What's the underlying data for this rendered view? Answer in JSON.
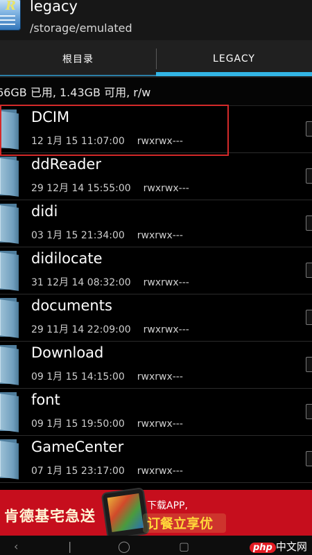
{
  "header": {
    "title": "legacy",
    "path": "/storage/emulated"
  },
  "tabs": [
    {
      "label": "根目录"
    },
    {
      "label": "LEGACY"
    }
  ],
  "storage_info": "66GB 已用, 1.43GB 可用, r/w",
  "files": [
    {
      "name": "DCIM",
      "date": "12 1月 15 11:07:00",
      "permissions": "rwxrwx---"
    },
    {
      "name": "ddReader",
      "date": "29 12月 14 15:55:00",
      "permissions": "rwxrwx---"
    },
    {
      "name": "didi",
      "date": "03 1月 15 21:34:00",
      "permissions": "rwxrwx---"
    },
    {
      "name": "didilocate",
      "date": "31 12月 14 08:32:00",
      "permissions": "rwxrwx---"
    },
    {
      "name": "documents",
      "date": "29 11月 14 22:09:00",
      "permissions": "rwxrwx---"
    },
    {
      "name": "Download",
      "date": "09 1月 15 14:15:00",
      "permissions": "rwxrwx---"
    },
    {
      "name": "font",
      "date": "09 1月 15 19:50:00",
      "permissions": "rwxrwx---"
    },
    {
      "name": "GameCenter",
      "date": "07 1月 15 23:17:00",
      "permissions": "rwxrwx---"
    }
  ],
  "ad": {
    "brand": "肯德基宅急送",
    "line1": "下载APP,",
    "line2": "订餐立享优"
  },
  "watermark": {
    "badge": "php",
    "site": "中文网"
  },
  "colors": {
    "accent": "#33b5e5",
    "highlight": "#d42a2a",
    "ad_background": "#c60e1d"
  },
  "icons": {
    "app": "root-explorer-icon",
    "folder": "folder-icon",
    "nav": [
      "back-icon",
      "home-icon",
      "recents-icon"
    ]
  }
}
